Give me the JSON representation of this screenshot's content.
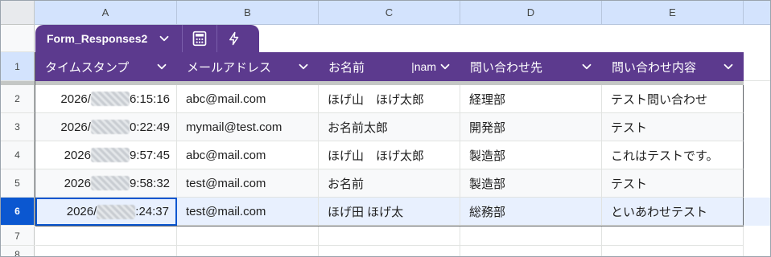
{
  "columns": [
    "A",
    "B",
    "C",
    "D",
    "E"
  ],
  "row_numbers": [
    "1",
    "2",
    "3",
    "4",
    "5",
    "6",
    "7",
    "8"
  ],
  "table": {
    "name": "Form_Responses2",
    "headers": [
      "タイムスタンプ",
      "メールアドレス",
      "お名前",
      "問い合わせ先",
      "問い合わせ内容"
    ],
    "header_c_extra": "|nam",
    "rows": [
      {
        "ts_prefix": "2026/",
        "ts_suffix": "6:15:16",
        "email": "abc@mail.com",
        "name": "ほげ山　ほげ太郎",
        "dept": "経理部",
        "content": "テスト問い合わせ"
      },
      {
        "ts_prefix": "2026/",
        "ts_suffix": "0:22:49",
        "email": "mymail@test.com",
        "name": "お名前太郎",
        "dept": "開発部",
        "content": "テスト"
      },
      {
        "ts_prefix": "2026",
        "ts_suffix": "9:57:45",
        "email": "abc@mail.com",
        "name": "ほげ山　ほげ太郎",
        "dept": "製造部",
        "content": "これはテストです。"
      },
      {
        "ts_prefix": "2026",
        "ts_suffix": "9:58:32",
        "email": "test@mail.com",
        "name": "お名前",
        "dept": "製造部",
        "content": "テスト"
      },
      {
        "ts_prefix": "2026/",
        "ts_suffix": ":24:37",
        "email": "test@mail.com",
        "name": "ほげ田 ほげ太",
        "dept": "総務部",
        "content": "といあわせテスト"
      }
    ]
  },
  "selected_row": "6",
  "colors": {
    "table_purple": "#5c3a8e",
    "selection_blue": "#0b57d0",
    "header_blue": "#d3e3fd"
  },
  "icons": {
    "table_menu": "chevron-down-icon",
    "calculator": "calculator-icon",
    "automation": "lightning-bolt-icon"
  }
}
